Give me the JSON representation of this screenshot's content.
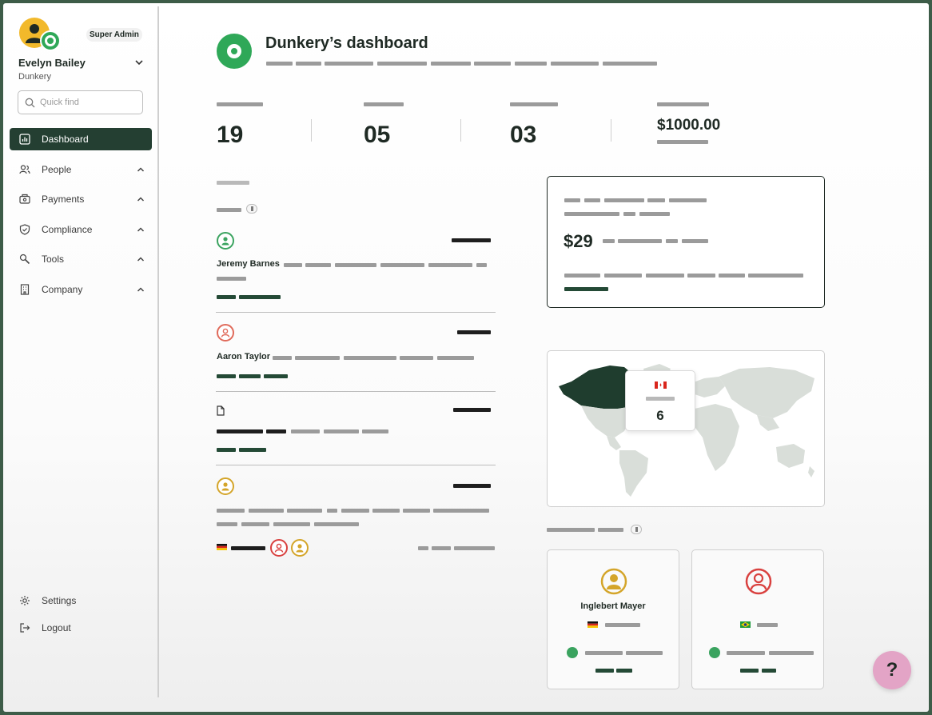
{
  "user": {
    "name": "Evelyn Bailey",
    "organization": "Dunkery",
    "role": "Super Admin"
  },
  "search": {
    "placeholder": "Quick find"
  },
  "sidebar": {
    "items": [
      {
        "label": "Dashboard",
        "icon": "chart-icon",
        "active": true
      },
      {
        "label": "People",
        "icon": "people-icon"
      },
      {
        "label": "Payments",
        "icon": "wallet-icon"
      },
      {
        "label": "Compliance",
        "icon": "shield-icon"
      },
      {
        "label": "Tools",
        "icon": "wrench-icon"
      },
      {
        "label": "Company",
        "icon": "building-icon"
      }
    ],
    "bottom": [
      {
        "label": "Settings",
        "icon": "gear-icon"
      },
      {
        "label": "Logout",
        "icon": "logout-icon"
      }
    ]
  },
  "header": {
    "title": "Dunkery’s dashboard"
  },
  "stats": [
    {
      "value": "19"
    },
    {
      "value": "05"
    },
    {
      "value": "03"
    },
    {
      "value": "$1000.00"
    }
  ],
  "activity": [
    {
      "name": "Jeremy Barnes",
      "icon_color": "#3aa35f"
    },
    {
      "name": "Aaron Taylor",
      "icon_color": "#e06a5a"
    },
    {
      "name": "",
      "icon": "document-icon"
    },
    {
      "name": "",
      "icon_color": "#d4a52a"
    }
  ],
  "balance": {
    "amount": "$29"
  },
  "map": {
    "country_flag": "Canada",
    "count": "6"
  },
  "employees": [
    {
      "name": "Inglebert Mayer",
      "flag": "Germany",
      "icon_color": "#d4a52a"
    },
    {
      "name": "",
      "flag": "Brazil",
      "icon_color": "#d9413f"
    }
  ],
  "help": {
    "label": "?"
  },
  "colors": {
    "sidebar_active": "#243f32",
    "brand_green": "#2fa858",
    "card_border": "#1f2a24",
    "help_button": "#e3a4c6"
  }
}
